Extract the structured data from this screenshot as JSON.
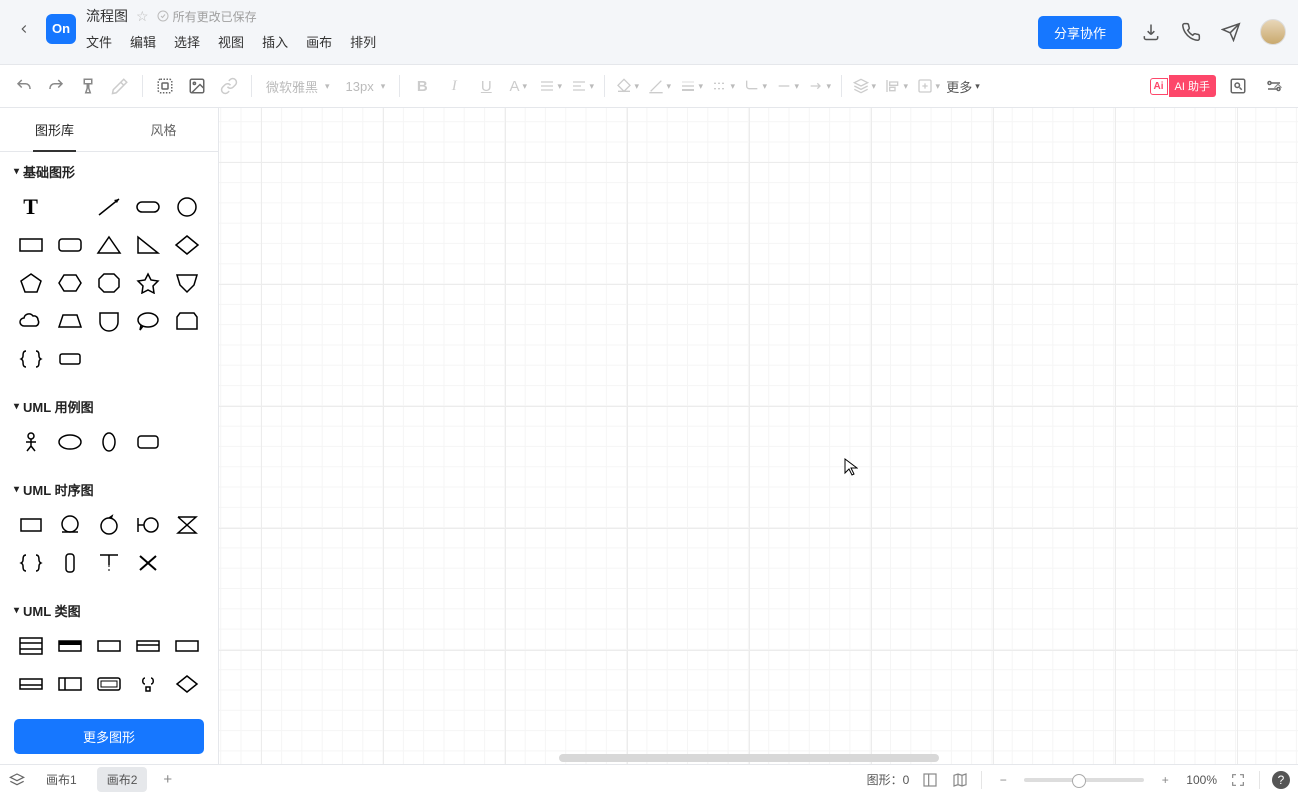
{
  "header": {
    "logo_text": "On",
    "doc_title": "流程图",
    "save_status": "所有更改已保存",
    "menus": [
      "文件",
      "编辑",
      "选择",
      "视图",
      "插入",
      "画布",
      "排列"
    ],
    "share_label": "分享协作"
  },
  "toolbar": {
    "font_name": "微软雅黑",
    "font_size": "13px",
    "more_label": "更多",
    "ai_icon": "Ai",
    "ai_label": "AI 助手"
  },
  "sidebar": {
    "tabs": [
      "图形库",
      "风格"
    ],
    "categories": [
      {
        "label": "基础图形"
      },
      {
        "label": "UML 用例图"
      },
      {
        "label": "UML 时序图"
      },
      {
        "label": "UML 类图"
      }
    ],
    "more_shapes_label": "更多图形"
  },
  "bottombar": {
    "canvas_tabs": [
      "画布1",
      "画布2"
    ],
    "shape_count_label": "图形：",
    "shape_count": "0",
    "zoom_label": "100%"
  }
}
